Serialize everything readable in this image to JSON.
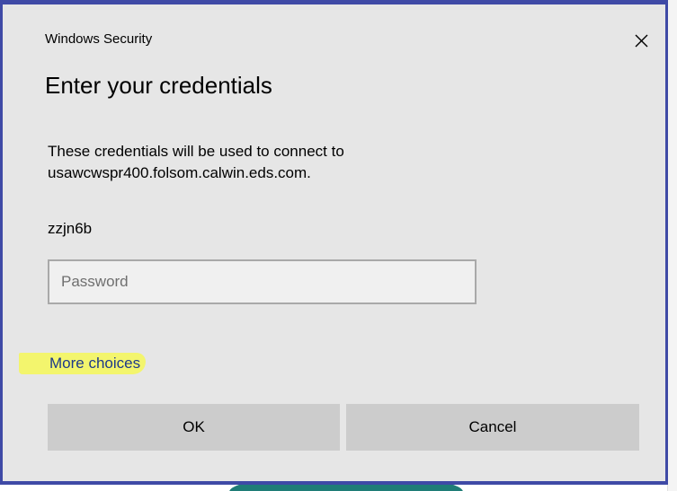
{
  "window": {
    "title": "Windows Security",
    "close_icon": "close-icon"
  },
  "dialog": {
    "heading": "Enter your credentials",
    "message_line1": "These credentials will be used to connect to",
    "message_line2": "usawcwspr400.folsom.calwin.eds.com.",
    "username": "zzjn6b",
    "password": {
      "value": "",
      "placeholder": "Password"
    },
    "more_choices_label": "More choices",
    "ok_label": "OK",
    "cancel_label": "Cancel"
  },
  "colors": {
    "dialog_border": "#3f4aa6",
    "highlight": "#f3f56d",
    "button_bg": "#cccccc"
  }
}
